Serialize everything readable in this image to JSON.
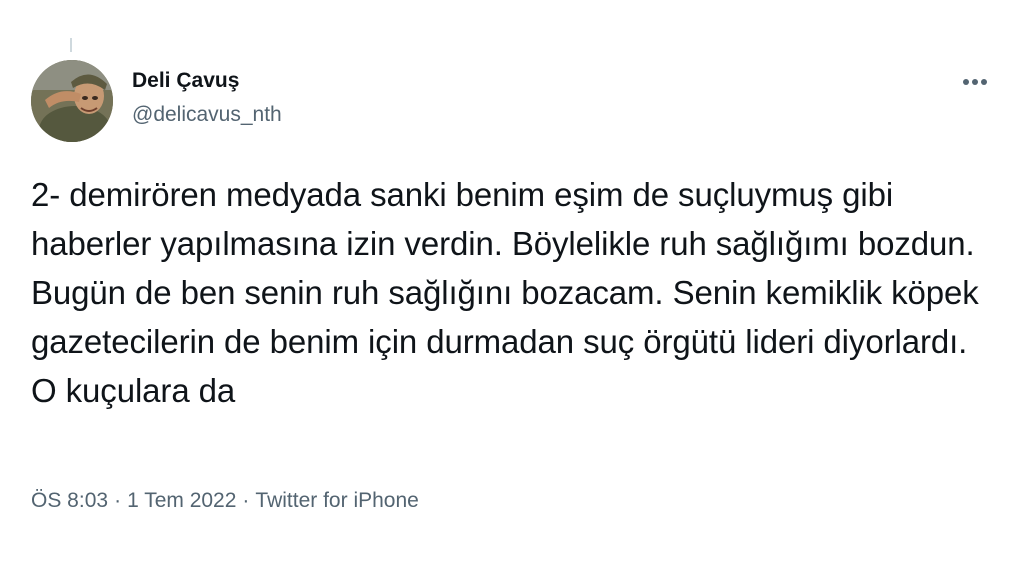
{
  "tweet": {
    "author": {
      "display_name": "Deli Çavuş",
      "handle": "@delicavus_nth"
    },
    "text": "2- demirören medyada sanki benim eşim de suçluymuş gibi haberler yapılmasına izin verdin. Böylelikle ruh sağlığımı bozdun. Bugün de ben senin ruh sağlığını bozacam. Senin kemiklik köpek gazetecilerin de benim için durmadan suç örgütü lideri diyorlardı. O kuçulara da",
    "time": "ÖS 8:03",
    "separator": "·",
    "date": "1 Tem 2022",
    "source": "Twitter for iPhone"
  },
  "icons": {
    "more": "more-horizontal-icon",
    "avatar": "profile-photo"
  },
  "colors": {
    "text_primary": "#0f1419",
    "text_secondary": "#536471",
    "background": "#ffffff"
  }
}
